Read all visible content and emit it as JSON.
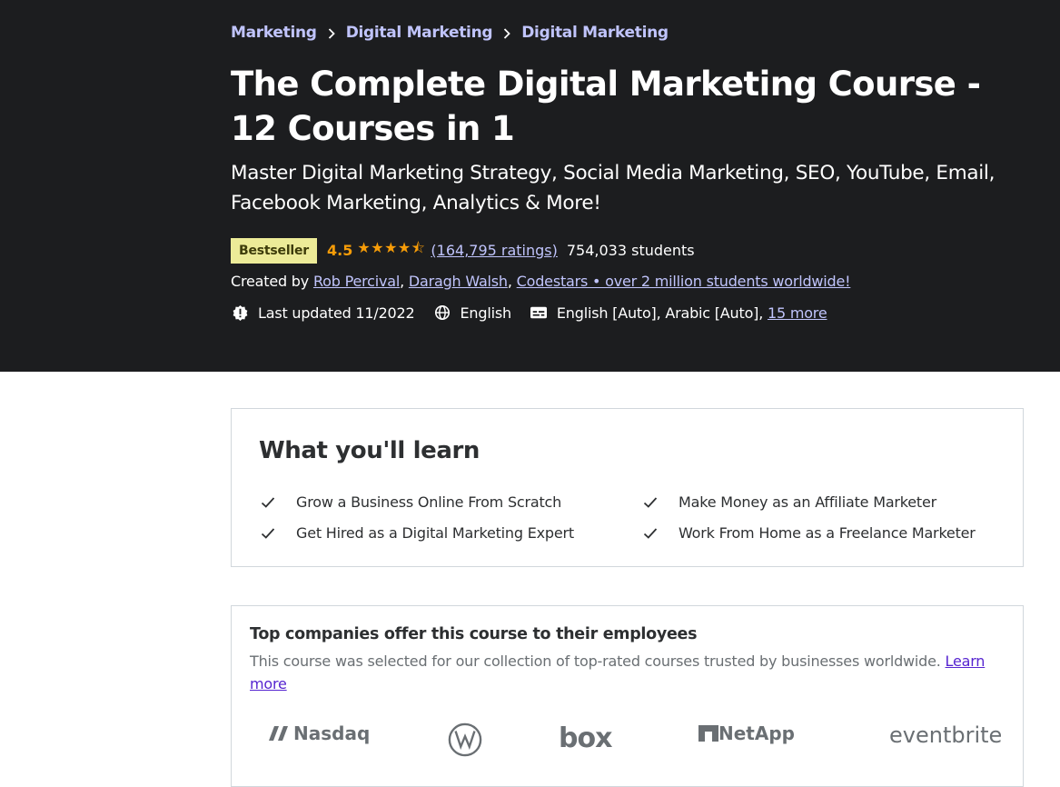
{
  "breadcrumb": [
    {
      "label": "Marketing"
    },
    {
      "label": "Digital Marketing"
    },
    {
      "label": "Digital Marketing"
    }
  ],
  "course": {
    "title": "The Complete Digital Marketing Course - 12 Courses in 1",
    "subtitle": "Master Digital Marketing Strategy, Social Media Marketing, SEO, YouTube, Email, Facebook Marketing, Analytics & More!",
    "badge": "Bestseller",
    "rating": "4.5",
    "stars": "★★★★⯪",
    "rating_value": 4.5,
    "ratings_count": "(164,795 ratings)",
    "students": "754,033 students",
    "created_by_label": "Created by",
    "instructors": [
      {
        "name": "Rob Percival"
      },
      {
        "name": "Daragh Walsh"
      },
      {
        "name": "Codestars • over 2 million students worldwide!"
      }
    ],
    "separator": ",",
    "last_updated": "Last updated 11/2022",
    "language": "English",
    "captions": "English [Auto], Arabic [Auto],",
    "captions_more": "15 more"
  },
  "icons": {
    "last_updated": "alert-badge-icon",
    "language": "globe-icon",
    "captions": "closed-captions-icon",
    "chevron": "chevron-right-icon",
    "check": "check-icon"
  },
  "learn": {
    "title": "What you'll learn",
    "items": [
      {
        "text": "Grow a Business Online From Scratch"
      },
      {
        "text": "Make Money as an Affiliate Marketer"
      },
      {
        "text": "Get Hired as a Digital Marketing Expert"
      },
      {
        "text": "Work From Home as a Freelance Marketer"
      }
    ]
  },
  "companies": {
    "title": "Top companies offer this course to their employees",
    "description": "This course was selected for our collection of top-rated courses trusted by businesses worldwide.",
    "learn_more": "Learn more",
    "logos": [
      {
        "name": "Nasdaq"
      },
      {
        "name": "VW"
      },
      {
        "name": "box"
      },
      {
        "name": "NetApp"
      },
      {
        "name": "eventbrite"
      }
    ]
  },
  "colors": {
    "hero_bg": "#1c1d1f",
    "link_light": "#c0c4fc",
    "star": "#f69c08",
    "badge_bg": "#eceb98",
    "link_purple": "#5624d0"
  }
}
